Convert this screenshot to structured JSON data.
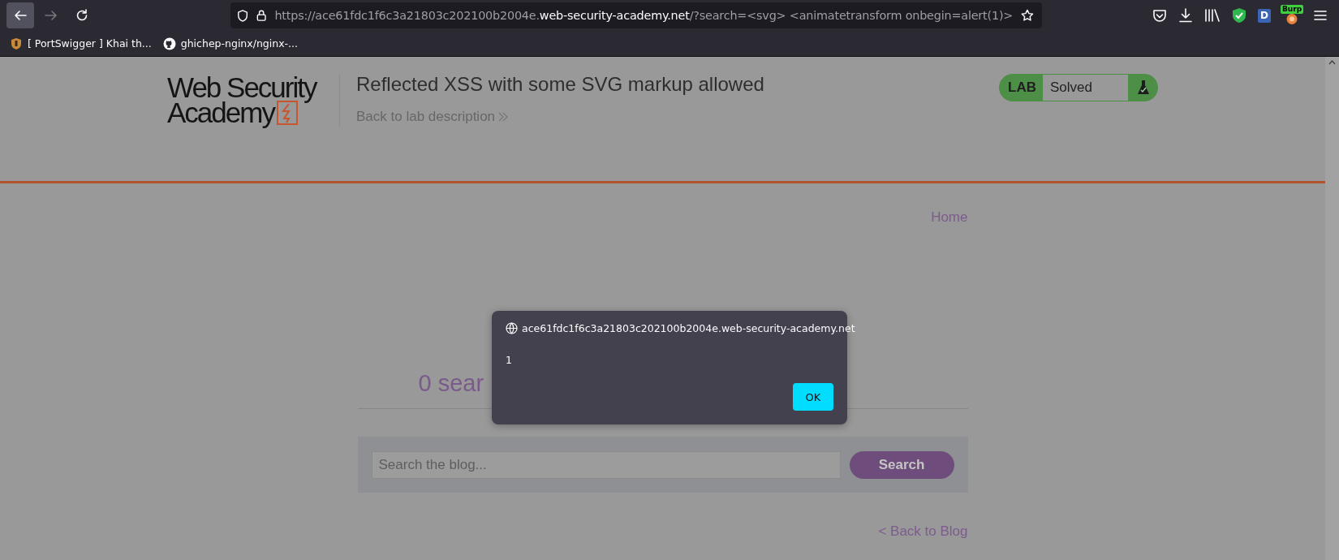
{
  "browser": {
    "url": [
      {
        "text": "https://ace61fdc1f6c3a21803c202100b2004e.",
        "emphasis": false
      },
      {
        "text": "web-security-academy.net",
        "emphasis": true
      },
      {
        "text": "/?search=<svg> <animatetransform onbegin=alert(1)>",
        "emphasis": false
      }
    ],
    "bookmarks": [
      {
        "label": "[ PortSwigger ] Khai th..."
      },
      {
        "label": "ghichep-nginx/nginx-..."
      }
    ],
    "extensions": [
      {
        "kind": "pocket"
      },
      {
        "kind": "download"
      },
      {
        "kind": "library"
      },
      {
        "kind": "shield"
      },
      {
        "kind": "letter",
        "label": "D"
      },
      {
        "kind": "burp",
        "label": "Burp"
      },
      {
        "kind": "menu"
      }
    ]
  },
  "header": {
    "logo": [
      "Web Security",
      "Academy"
    ],
    "title": "Reflected XSS with some SVG markup allowed",
    "back_link": "Back to lab description",
    "lab_badge": {
      "label": "LAB",
      "status": "Solved",
      "solved": true
    }
  },
  "nav": [
    "Home"
  ],
  "heading": "0 sear",
  "search": {
    "placeholder": "Search the blog...",
    "button": "Search"
  },
  "back_link": "< Back to Blog",
  "dialog": {
    "origin": "ace61fdc1f6c3a21803c202100b2004e.web-security-academy.net",
    "message": "1",
    "button": "OK"
  }
}
